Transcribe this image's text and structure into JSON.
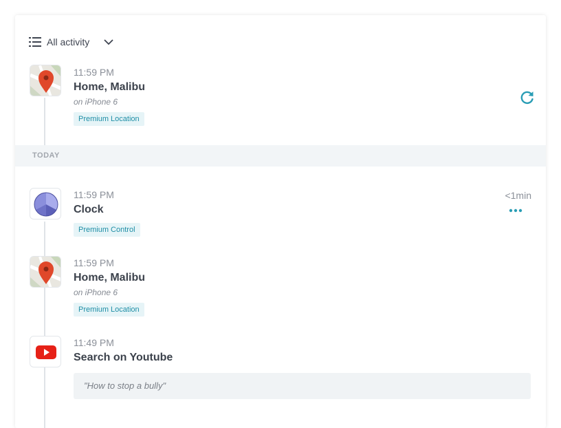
{
  "filter": {
    "label": "All activity",
    "icon": "list-icon"
  },
  "header_entry": {
    "time": "11:59 PM",
    "title": "Home, Malibu",
    "device": "on iPhone 6",
    "badge": "Premium Location",
    "icon": "map-pin-icon",
    "action_icon": "refresh-icon"
  },
  "section_label": "TODAY",
  "entries": [
    {
      "time": "11:59 PM",
      "title": "Clock",
      "badge": "Premium Control",
      "duration": "<1min",
      "icon": "clock-app-icon",
      "action_icon": "more-icon"
    },
    {
      "time": "11:59 PM",
      "title": "Home, Malibu",
      "device": "on iPhone 6",
      "badge": "Premium Location",
      "icon": "map-pin-icon"
    },
    {
      "time": "11:49 PM",
      "title": "Search on Youtube",
      "query": "\"How to stop a bully\"",
      "icon": "youtube-icon"
    }
  ],
  "colors": {
    "accent": "#1e8ea6",
    "badge_bg": "#e6f4f7",
    "pin": "#e0482a",
    "youtube": "#e62117",
    "clock": "#7d82d6",
    "section_bg": "#f2f5f7"
  }
}
